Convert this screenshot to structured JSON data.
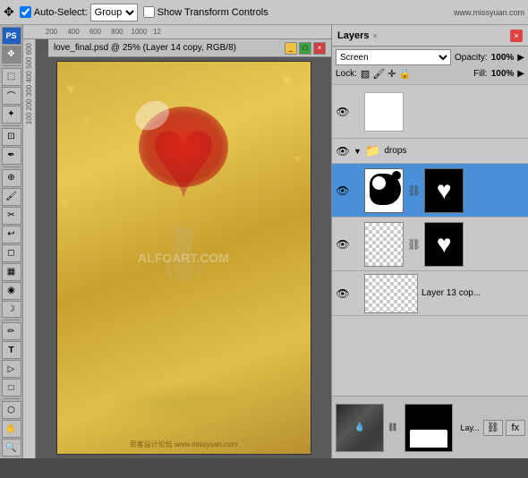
{
  "app": {
    "title": "Adobe Photoshop"
  },
  "toolbar": {
    "auto_select_label": "Auto-Select:",
    "group_label": "Group",
    "show_transform_label": "Show Transform Controls",
    "website": "www.missyuan.com"
  },
  "canvas": {
    "title": "love_final.psd @ 25% (Layer 14 copy, RGB/8)",
    "watermark": "ALFOART.COM",
    "zoom": "25%",
    "ruler_marks": [
      "200",
      "400",
      "600",
      "800",
      "1000",
      "12"
    ]
  },
  "layers_panel": {
    "title": "Layers",
    "close_btn": "×",
    "blend_mode": "Screen",
    "opacity_label": "Opacity:",
    "opacity_value": "100%",
    "lock_label": "Lock:",
    "fill_label": "Fill:",
    "fill_value": "100%",
    "group_name": "drops",
    "layers": [
      {
        "id": 1,
        "name": "",
        "type": "white-layer",
        "visible": true,
        "selected": false
      },
      {
        "id": 2,
        "name": "drops",
        "type": "group",
        "visible": true,
        "selected": false
      },
      {
        "id": 3,
        "name": "",
        "type": "layer-with-mask",
        "visible": true,
        "selected": true
      },
      {
        "id": 4,
        "name": "",
        "type": "layer-with-mask-2",
        "visible": true,
        "selected": false
      },
      {
        "id": 5,
        "name": "Layer 13 cop...",
        "type": "layer-blank",
        "visible": true,
        "selected": false
      }
    ],
    "strip_layers": [
      {
        "id": "s1",
        "name": "Lay...",
        "type": "dark-photo"
      },
      {
        "id": "s2",
        "name": "",
        "type": "black-mask"
      }
    ],
    "bottom_buttons": [
      "link",
      "fx",
      "mask",
      "adjustment",
      "group",
      "new",
      "trash"
    ]
  },
  "bottom_bar": {
    "website": "思客设计论坛 www.missyuan.com"
  }
}
